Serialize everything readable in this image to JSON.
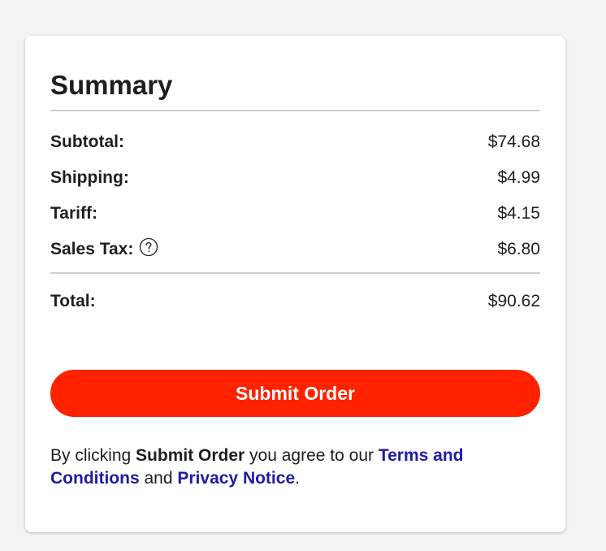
{
  "summary": {
    "title": "Summary",
    "rows": [
      {
        "label": "Subtotal:",
        "value": "$74.68"
      },
      {
        "label": "Shipping:",
        "value": "$4.99"
      },
      {
        "label": "Tariff:",
        "value": "$4.15"
      },
      {
        "label": "Sales Tax:",
        "value": "$6.80",
        "icon": "help-circle-icon"
      }
    ],
    "total": {
      "label": "Total:",
      "value": "$90.62"
    },
    "submit_label": "Submit Order",
    "legal": {
      "prefix": "By clicking ",
      "button_ref": "Submit Order",
      "middle": " you agree to our ",
      "terms_link": "Terms and Conditions",
      "conjunction": " and ",
      "privacy_link": "Privacy Notice",
      "suffix": "."
    }
  },
  "colors": {
    "accent": "#ff2200",
    "link": "#1f1ba8",
    "background": "#f3f3f3",
    "card": "#ffffff"
  }
}
